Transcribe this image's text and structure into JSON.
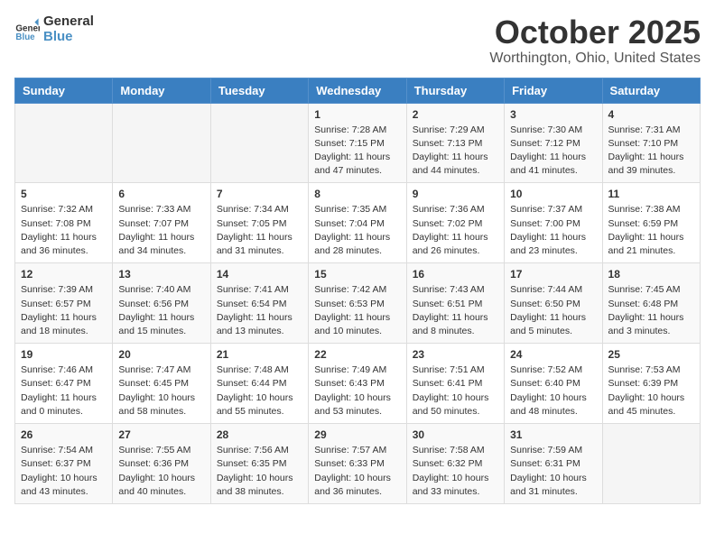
{
  "header": {
    "logo_general": "General",
    "logo_blue": "Blue",
    "month": "October 2025",
    "location": "Worthington, Ohio, United States"
  },
  "weekdays": [
    "Sunday",
    "Monday",
    "Tuesday",
    "Wednesday",
    "Thursday",
    "Friday",
    "Saturday"
  ],
  "weeks": [
    [
      {
        "day": "",
        "info": ""
      },
      {
        "day": "",
        "info": ""
      },
      {
        "day": "",
        "info": ""
      },
      {
        "day": "1",
        "info": "Sunrise: 7:28 AM\nSunset: 7:15 PM\nDaylight: 11 hours and 47 minutes."
      },
      {
        "day": "2",
        "info": "Sunrise: 7:29 AM\nSunset: 7:13 PM\nDaylight: 11 hours and 44 minutes."
      },
      {
        "day": "3",
        "info": "Sunrise: 7:30 AM\nSunset: 7:12 PM\nDaylight: 11 hours and 41 minutes."
      },
      {
        "day": "4",
        "info": "Sunrise: 7:31 AM\nSunset: 7:10 PM\nDaylight: 11 hours and 39 minutes."
      }
    ],
    [
      {
        "day": "5",
        "info": "Sunrise: 7:32 AM\nSunset: 7:08 PM\nDaylight: 11 hours and 36 minutes."
      },
      {
        "day": "6",
        "info": "Sunrise: 7:33 AM\nSunset: 7:07 PM\nDaylight: 11 hours and 34 minutes."
      },
      {
        "day": "7",
        "info": "Sunrise: 7:34 AM\nSunset: 7:05 PM\nDaylight: 11 hours and 31 minutes."
      },
      {
        "day": "8",
        "info": "Sunrise: 7:35 AM\nSunset: 7:04 PM\nDaylight: 11 hours and 28 minutes."
      },
      {
        "day": "9",
        "info": "Sunrise: 7:36 AM\nSunset: 7:02 PM\nDaylight: 11 hours and 26 minutes."
      },
      {
        "day": "10",
        "info": "Sunrise: 7:37 AM\nSunset: 7:00 PM\nDaylight: 11 hours and 23 minutes."
      },
      {
        "day": "11",
        "info": "Sunrise: 7:38 AM\nSunset: 6:59 PM\nDaylight: 11 hours and 21 minutes."
      }
    ],
    [
      {
        "day": "12",
        "info": "Sunrise: 7:39 AM\nSunset: 6:57 PM\nDaylight: 11 hours and 18 minutes."
      },
      {
        "day": "13",
        "info": "Sunrise: 7:40 AM\nSunset: 6:56 PM\nDaylight: 11 hours and 15 minutes."
      },
      {
        "day": "14",
        "info": "Sunrise: 7:41 AM\nSunset: 6:54 PM\nDaylight: 11 hours and 13 minutes."
      },
      {
        "day": "15",
        "info": "Sunrise: 7:42 AM\nSunset: 6:53 PM\nDaylight: 11 hours and 10 minutes."
      },
      {
        "day": "16",
        "info": "Sunrise: 7:43 AM\nSunset: 6:51 PM\nDaylight: 11 hours and 8 minutes."
      },
      {
        "day": "17",
        "info": "Sunrise: 7:44 AM\nSunset: 6:50 PM\nDaylight: 11 hours and 5 minutes."
      },
      {
        "day": "18",
        "info": "Sunrise: 7:45 AM\nSunset: 6:48 PM\nDaylight: 11 hours and 3 minutes."
      }
    ],
    [
      {
        "day": "19",
        "info": "Sunrise: 7:46 AM\nSunset: 6:47 PM\nDaylight: 11 hours and 0 minutes."
      },
      {
        "day": "20",
        "info": "Sunrise: 7:47 AM\nSunset: 6:45 PM\nDaylight: 10 hours and 58 minutes."
      },
      {
        "day": "21",
        "info": "Sunrise: 7:48 AM\nSunset: 6:44 PM\nDaylight: 10 hours and 55 minutes."
      },
      {
        "day": "22",
        "info": "Sunrise: 7:49 AM\nSunset: 6:43 PM\nDaylight: 10 hours and 53 minutes."
      },
      {
        "day": "23",
        "info": "Sunrise: 7:51 AM\nSunset: 6:41 PM\nDaylight: 10 hours and 50 minutes."
      },
      {
        "day": "24",
        "info": "Sunrise: 7:52 AM\nSunset: 6:40 PM\nDaylight: 10 hours and 48 minutes."
      },
      {
        "day": "25",
        "info": "Sunrise: 7:53 AM\nSunset: 6:39 PM\nDaylight: 10 hours and 45 minutes."
      }
    ],
    [
      {
        "day": "26",
        "info": "Sunrise: 7:54 AM\nSunset: 6:37 PM\nDaylight: 10 hours and 43 minutes."
      },
      {
        "day": "27",
        "info": "Sunrise: 7:55 AM\nSunset: 6:36 PM\nDaylight: 10 hours and 40 minutes."
      },
      {
        "day": "28",
        "info": "Sunrise: 7:56 AM\nSunset: 6:35 PM\nDaylight: 10 hours and 38 minutes."
      },
      {
        "day": "29",
        "info": "Sunrise: 7:57 AM\nSunset: 6:33 PM\nDaylight: 10 hours and 36 minutes."
      },
      {
        "day": "30",
        "info": "Sunrise: 7:58 AM\nSunset: 6:32 PM\nDaylight: 10 hours and 33 minutes."
      },
      {
        "day": "31",
        "info": "Sunrise: 7:59 AM\nSunset: 6:31 PM\nDaylight: 10 hours and 31 minutes."
      },
      {
        "day": "",
        "info": ""
      }
    ]
  ]
}
